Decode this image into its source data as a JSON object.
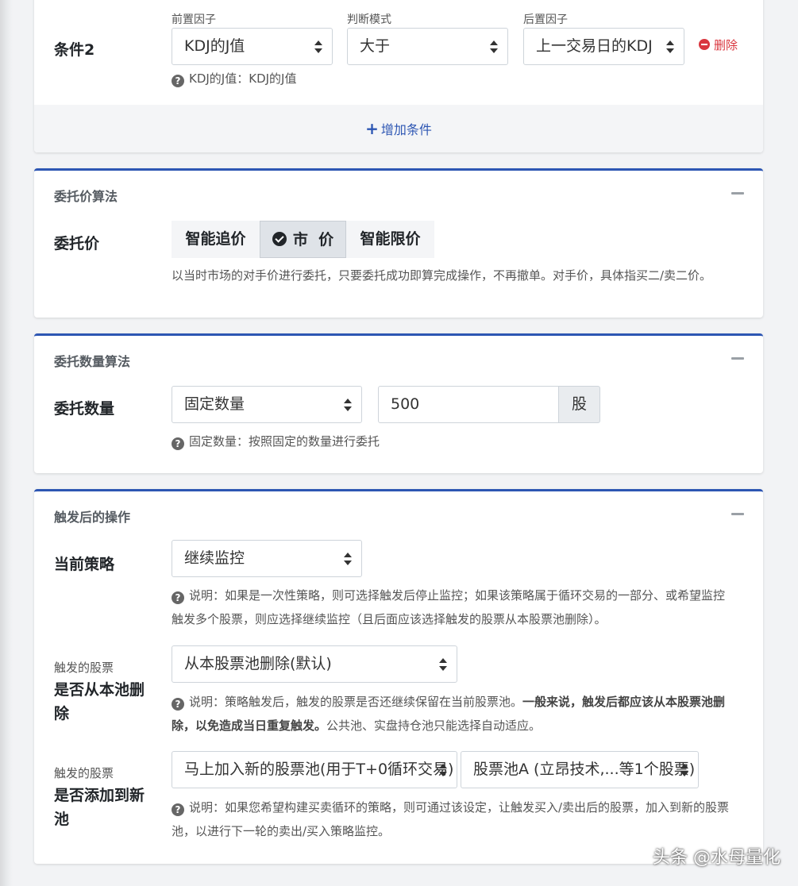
{
  "condition2": {
    "label": "条件2",
    "front_factor": {
      "label": "前置因子",
      "value": "KDJ的J值"
    },
    "judge_mode": {
      "label": "判断模式",
      "value": "大于"
    },
    "back_factor": {
      "label": "后置因子",
      "value": "上一交易日的KDJ"
    },
    "delete_label": "删除",
    "help": "KDJ的J值：KDJ的J值"
  },
  "add_condition_label": "增加条件",
  "price_algo": {
    "title": "委托价算法",
    "row_label": "委托价",
    "options": [
      "智能追价",
      "市  价",
      "智能限价"
    ],
    "selected_index": 1,
    "help": "以当时市场的对手价进行委托，只要委托成功即算完成操作，不再撤单。对手价，具体指买二/卖二价。"
  },
  "qty_algo": {
    "title": "委托数量算法",
    "row_label": "委托数量",
    "mode": "固定数量",
    "quantity": "500",
    "unit": "股",
    "help": "固定数量：按照固定的数量进行委托"
  },
  "after_trigger": {
    "title": "触发后的操作",
    "strategy": {
      "label": "当前策略",
      "value": "继续监控",
      "help": "说明：如果是一次性策略，则可选择触发后停止监控；如果该策略属于循环交易的一部分、或希望监控触发多个股票，则应选择继续监控（且后面应该选择触发的股票从本股票池删除）。"
    },
    "remove": {
      "small_label": "触发的股票",
      "label": "是否从本池删除",
      "value": "从本股票池删除(默认)",
      "help_pre": "说明：策略触发后，触发的股票是否还继续保留在当前股票池。",
      "help_bold": "一般来说，触发后都应该从本股票池删除，以免造成当日重复触发。",
      "help_post": "公共池、实盘持仓池只能选择自动适应。"
    },
    "add_new": {
      "small_label": "触发的股票",
      "label": "是否添加到新池",
      "value": "马上加入新的股票池(用于T+0循环交易)",
      "pool": "股票池A (立昂技术,...等1个股票)",
      "help": "说明：如果您希望构建买卖循环的策略，则可通过该设定，让触发买入/卖出后的股票，加入到新的股票池，以进行下一轮的卖出/买入策略监控。"
    }
  },
  "watermark": "头条 @水母量化"
}
